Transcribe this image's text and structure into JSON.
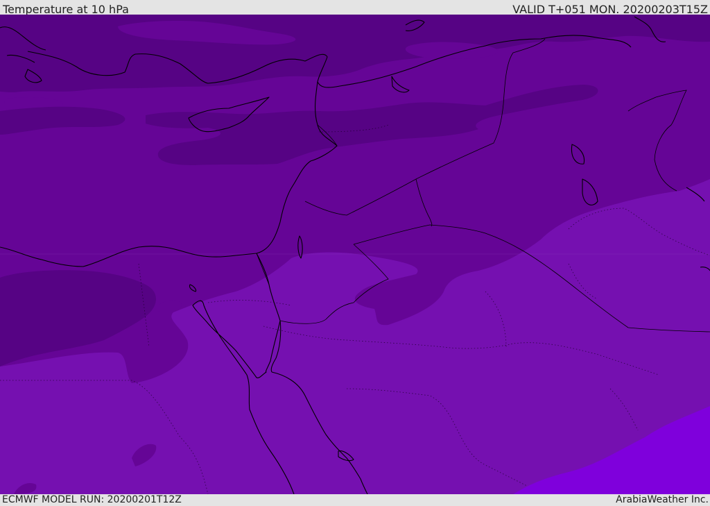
{
  "header": {
    "title": "Temperature at 10 hPa",
    "valid": "VALID T+051 MON. 20200203T15Z"
  },
  "footer": {
    "model_run": "ECMWF MODEL RUN: 20200201T12Z",
    "credit": "ArabiaWeather Inc."
  },
  "colors": {
    "band_darkest": "#560384",
    "band_dark": "#650596",
    "band_mid": "#7510b0",
    "band_light": "#7f00dc",
    "coastline": "#000000",
    "bar_bg": "#e4e4e4"
  }
}
